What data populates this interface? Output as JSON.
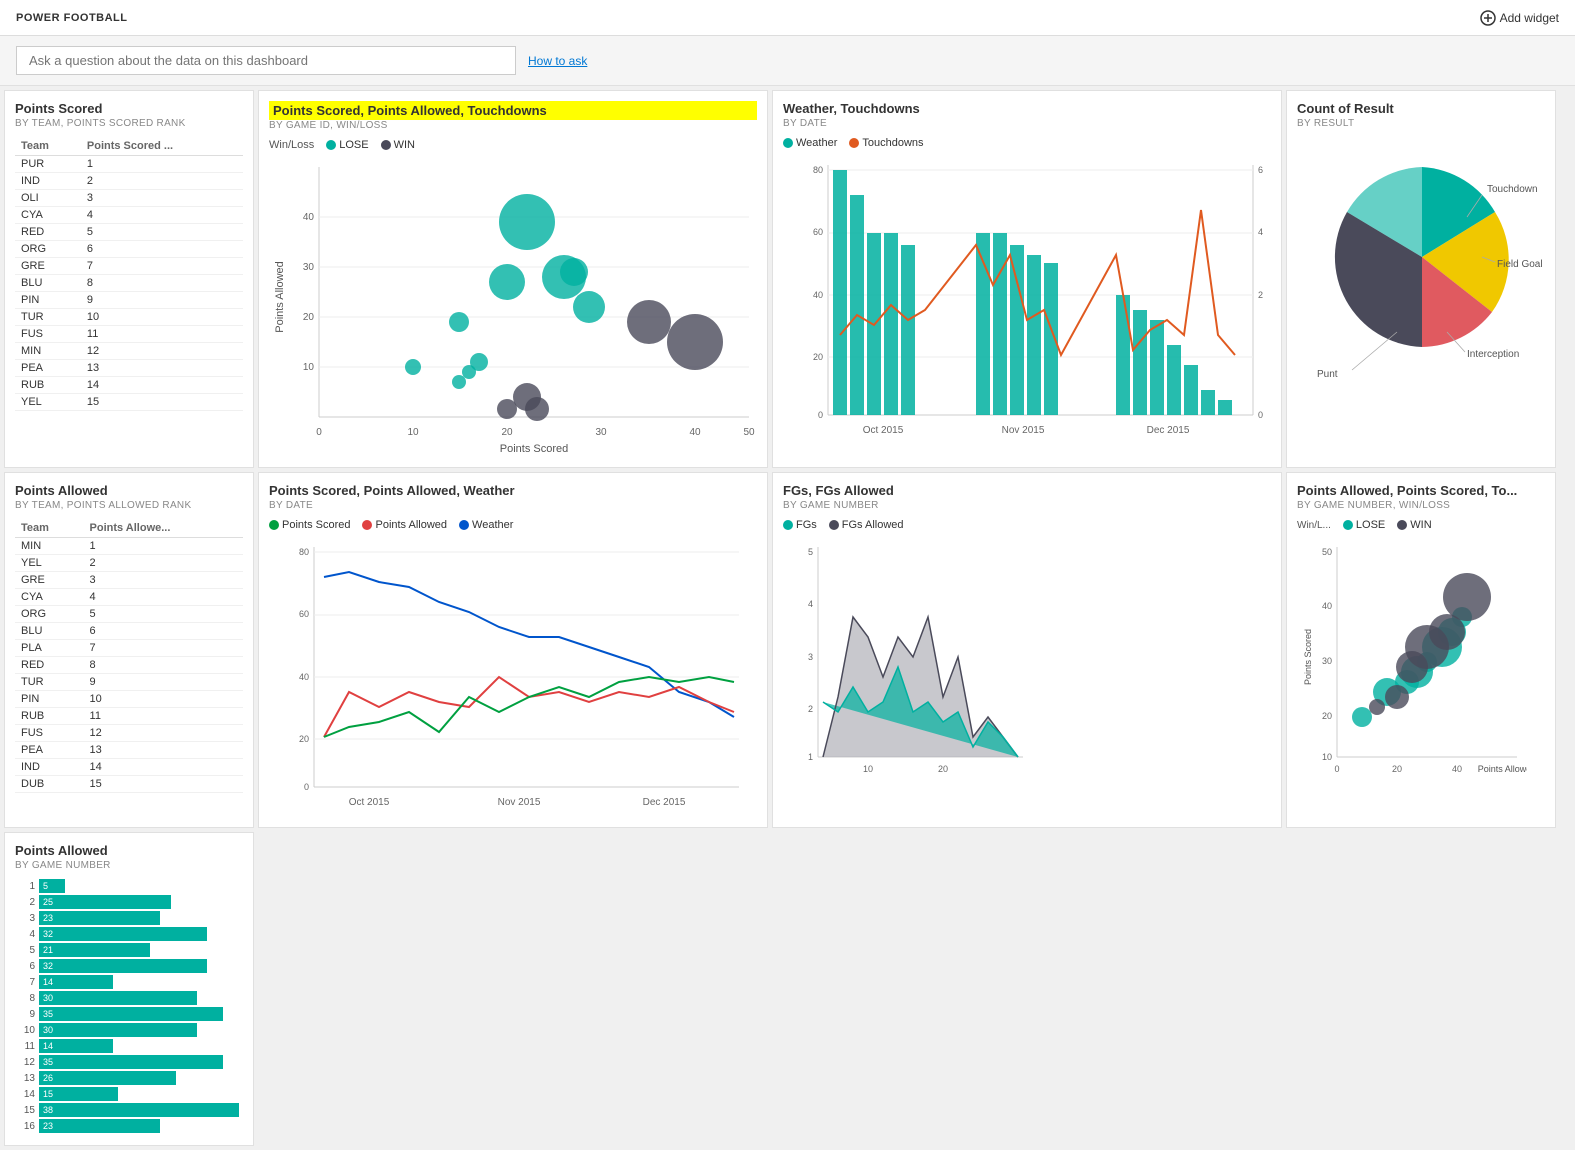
{
  "app": {
    "title": "POWER FOOTBALL",
    "add_widget_label": "Add widget"
  },
  "search": {
    "placeholder": "Ask a question about the data on this dashboard",
    "how_to_ask": "How to ask"
  },
  "widgets": {
    "points_scored": {
      "title": "Points Scored",
      "subtitle": "BY TEAM, POINTS SCORED RANK",
      "col_team": "Team",
      "col_points": "Points Scored ...",
      "rows": [
        [
          "PUR",
          "1"
        ],
        [
          "IND",
          "2"
        ],
        [
          "OLI",
          "3"
        ],
        [
          "CYA",
          "4"
        ],
        [
          "RED",
          "5"
        ],
        [
          "ORG",
          "6"
        ],
        [
          "GRE",
          "7"
        ],
        [
          "BLU",
          "8"
        ],
        [
          "PIN",
          "9"
        ],
        [
          "TUR",
          "10"
        ],
        [
          "FUS",
          "11"
        ],
        [
          "MIN",
          "12"
        ],
        [
          "PEA",
          "13"
        ],
        [
          "RUB",
          "14"
        ],
        [
          "YEL",
          "15"
        ]
      ]
    },
    "bubble_chart": {
      "title": "Points Scored, Points Allowed, Touchdowns",
      "subtitle": "BY GAME ID, WIN/LOSS",
      "legend_lose": "LOSE",
      "legend_win": "WIN"
    },
    "weather_touchdowns": {
      "title": "Weather, Touchdowns",
      "subtitle": "BY DATE",
      "legend_weather": "Weather",
      "legend_touchdowns": "Touchdowns",
      "x_labels": [
        "Oct 2015",
        "Nov 2015",
        "Dec 2015"
      ]
    },
    "count_result": {
      "title": "Count of Result",
      "subtitle": "BY RESULT",
      "labels": [
        "Touchdown",
        "Field Goal",
        "Punt",
        "Interception"
      ]
    },
    "points_allowed": {
      "title": "Points Allowed",
      "subtitle": "BY TEAM, POINTS ALLOWED RANK",
      "col_team": "Team",
      "col_points": "Points Allowe...",
      "rows": [
        [
          "MIN",
          "1"
        ],
        [
          "YEL",
          "2"
        ],
        [
          "GRE",
          "3"
        ],
        [
          "CYA",
          "4"
        ],
        [
          "ORG",
          "5"
        ],
        [
          "BLU",
          "6"
        ],
        [
          "PLA",
          "7"
        ],
        [
          "RED",
          "8"
        ],
        [
          "TUR",
          "9"
        ],
        [
          "PIN",
          "10"
        ],
        [
          "RUB",
          "11"
        ],
        [
          "FUS",
          "12"
        ],
        [
          "PEA",
          "13"
        ],
        [
          "IND",
          "14"
        ],
        [
          "DUB",
          "15"
        ]
      ]
    },
    "line_chart": {
      "title": "Points Scored, Points Allowed, Weather",
      "subtitle": "BY DATE",
      "legend_scored": "Points Scored",
      "legend_allowed": "Points Allowed",
      "legend_weather": "Weather",
      "x_labels": [
        "Oct 2015",
        "Nov 2015",
        "Dec 2015"
      ]
    },
    "fgs": {
      "title": "FGs, FGs Allowed",
      "subtitle": "BY GAME NUMBER",
      "legend_fgs": "FGs",
      "legend_fgs_allowed": "FGs Allowed"
    },
    "scatter2": {
      "title": "Points Allowed, Points Scored, To...",
      "subtitle": "BY GAME NUMBER, WIN/LOSS",
      "legend_lose": "LOSE",
      "legend_win": "WIN"
    },
    "bar_chart": {
      "title": "Points Allowed",
      "subtitle": "BY GAME NUMBER",
      "rows": [
        [
          "1",
          "5"
        ],
        [
          "2",
          "25"
        ],
        [
          "3",
          "23"
        ],
        [
          "4",
          "32"
        ],
        [
          "5",
          "21"
        ],
        [
          "6",
          "32"
        ],
        [
          "7",
          "14"
        ],
        [
          "8",
          "30"
        ],
        [
          "9",
          "35"
        ],
        [
          "10",
          "30"
        ],
        [
          "11",
          "14"
        ],
        [
          "12",
          "35"
        ],
        [
          "13",
          "26"
        ],
        [
          "14",
          "15"
        ],
        [
          "15",
          "38"
        ],
        [
          "16",
          "23"
        ]
      ]
    }
  }
}
